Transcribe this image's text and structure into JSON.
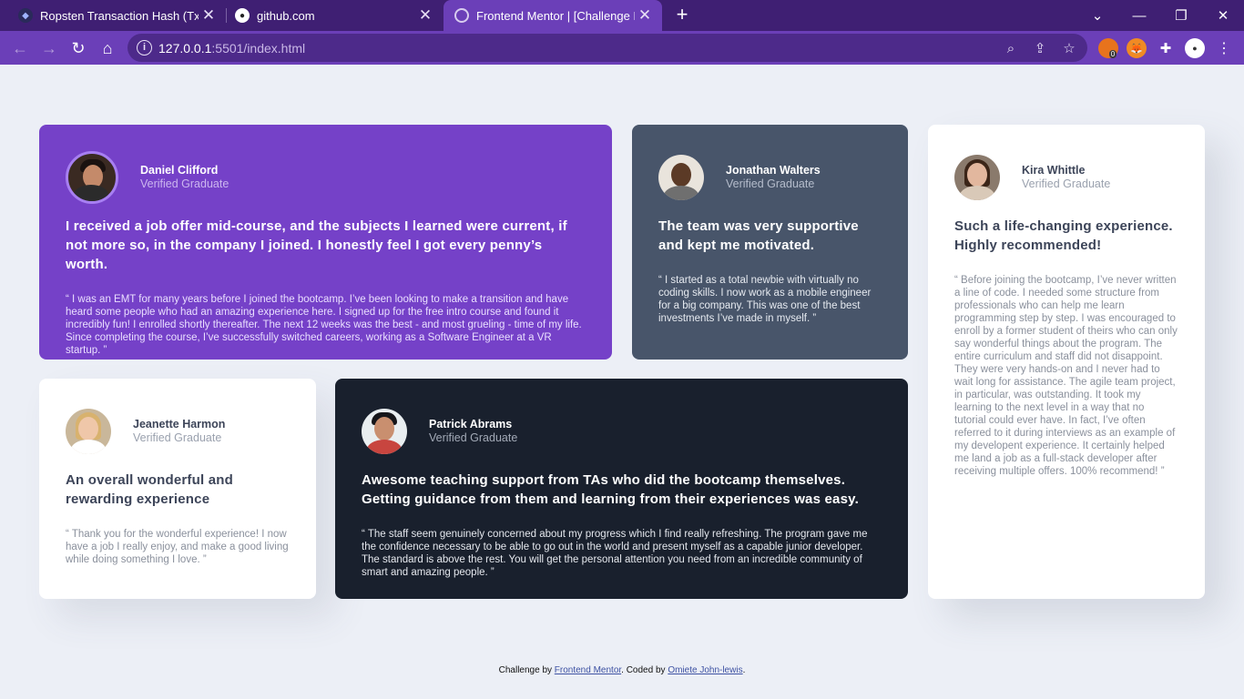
{
  "browser": {
    "tabs": [
      {
        "title": "Ropsten Transaction Hash (Txhash) D",
        "close": "✕",
        "icon": "ethereum-icon"
      },
      {
        "title": "github.com",
        "close": "✕",
        "icon": "github-icon"
      },
      {
        "title": "Frontend Mentor | [Challenge Name",
        "close": "✕",
        "icon": "page-loading-icon"
      }
    ],
    "new_tab": "+",
    "url_host": "127.0.0.1",
    "url_rest": ":5501/index.html",
    "extension_badge": "0"
  },
  "testimonials": [
    {
      "name": "Daniel Clifford",
      "role": "Verified Graduate",
      "headline": "I received a job offer mid-course, and the subjects I learned were current, if not more so, in the company I joined. I honestly feel I got every penny’s worth.",
      "quote": "“ I was an EMT for many years before I joined the bootcamp. I’ve been looking to make a transition and have heard some people who had an amazing experience here. I signed up for the free intro course and found it incredibly fun! I enrolled shortly thereafter. The next 12 weeks was the best - and most grueling - time of my life. Since completing the course, I’ve successfully switched careers, working as a Software Engineer at a VR startup. ”"
    },
    {
      "name": "Jonathan Walters",
      "role": "Verified Graduate",
      "headline": "The team was very supportive and kept me motivated.",
      "quote": "“ I started as a total newbie with virtually no coding skills. I now work as a mobile engineer for a big company. This was one of the best investments I’ve made in myself. ”"
    },
    {
      "name": "Kira Whittle",
      "role": "Verified Graduate",
      "headline": "Such a life-changing experience. Highly recommended!",
      "quote": "“ Before joining the bootcamp, I’ve never written a line of code. I needed some structure from professionals who can help me learn programming step by step. I was encouraged to enroll by a former student of theirs who can only say wonderful things about the program. The entire curriculum and staff did not disappoint. They were very hands-on and I never had to wait long for assistance. The agile team project, in particular, was outstanding. It took my learning to the next level in a way that no tutorial could ever have. In fact, I’ve often referred to it during interviews as an example of my developent experience. It certainly helped me land a job as a full-stack developer after receiving multiple offers. 100% recommend! ”"
    },
    {
      "name": "Jeanette Harmon",
      "role": "Verified Graduate",
      "headline": "An overall wonderful and rewarding experience",
      "quote": "“ Thank you for the wonderful experience! I now have a job I really enjoy, and make a good living while doing something I love. ”"
    },
    {
      "name": "Patrick Abrams",
      "role": "Verified Graduate",
      "headline": "Awesome teaching support from TAs who did the bootcamp themselves. Getting guidance from them and learning from their experiences was easy.",
      "quote": "“ The staff seem genuinely concerned about my progress which I find really refreshing. The program gave me the confidence necessary to be able to go out in the world and present myself as a capable junior developer. The standard is above the rest. You will get the personal attention you need from an incredible community of smart and amazing people. ”"
    }
  ],
  "footer": {
    "prefix": "Challenge by ",
    "link1": "Frontend Mentor",
    "middle": ". Coded by ",
    "link2": "Omiete John-lewis",
    "suffix": "."
  },
  "colors": {
    "purple_card": "#7541c8",
    "gray_card": "#48556a",
    "dark_card": "#19202d",
    "page_bg": "#eceff6",
    "browser_frame": "#3f1f73"
  }
}
